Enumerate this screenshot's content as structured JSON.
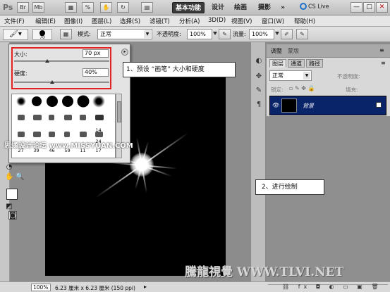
{
  "appbar": {
    "logo": "Ps",
    "workspace_buttons": [
      "基本功能",
      "设计",
      "绘画",
      "摄影",
      "»"
    ],
    "cs_live": "CS Live",
    "window_buttons": [
      "—",
      "□",
      "✕"
    ]
  },
  "menubar": {
    "items": [
      "文件(F)",
      "编辑(E)",
      "图像(I)",
      "图层(L)",
      "选择(S)",
      "滤镜(T)",
      "分析(A)",
      "3D(D)",
      "视图(V)",
      "窗口(W)",
      "帮助(H)"
    ]
  },
  "options": {
    "brush_size_small": "70",
    "mode_label": "模式:",
    "mode_value": "正常",
    "opacity_label": "不透明度:",
    "opacity_value": "100%",
    "flow_label": "流量:",
    "flow_value": "100%"
  },
  "brush_panel": {
    "size_label": "大小:",
    "size_value": "70 px",
    "hardness_label": "硬度:",
    "hardness_value": "40%",
    "size_slider": 0.35,
    "hardness_slider": 0.4,
    "preset_numbers": [
      "14",
      "24",
      "27",
      "39",
      "46",
      "59",
      "11",
      "17"
    ]
  },
  "callouts": {
    "step1": "1、预设 “画笔” 大小和硬度",
    "step2": "2、进行绘制"
  },
  "watermarks": {
    "left_site": "思缘设计论坛 www.MISSYUAN.COM",
    "bottom": "騰龍視覺 WWW.TLVI.NET"
  },
  "right_panel": {
    "top_tabs": [
      "调整",
      "蒙版"
    ],
    "layer_tabs": [
      "图层",
      "通道",
      "路径"
    ],
    "blend_mode": "正常",
    "opacity_label": "不透明度:",
    "lock_label": "锁定:",
    "fill_label": "填充:",
    "layer_name": "背景"
  },
  "statusbar": {
    "zoom": "100%",
    "doc_info": "6.23 厘米 x 6.23 厘米 (150 ppi)"
  }
}
